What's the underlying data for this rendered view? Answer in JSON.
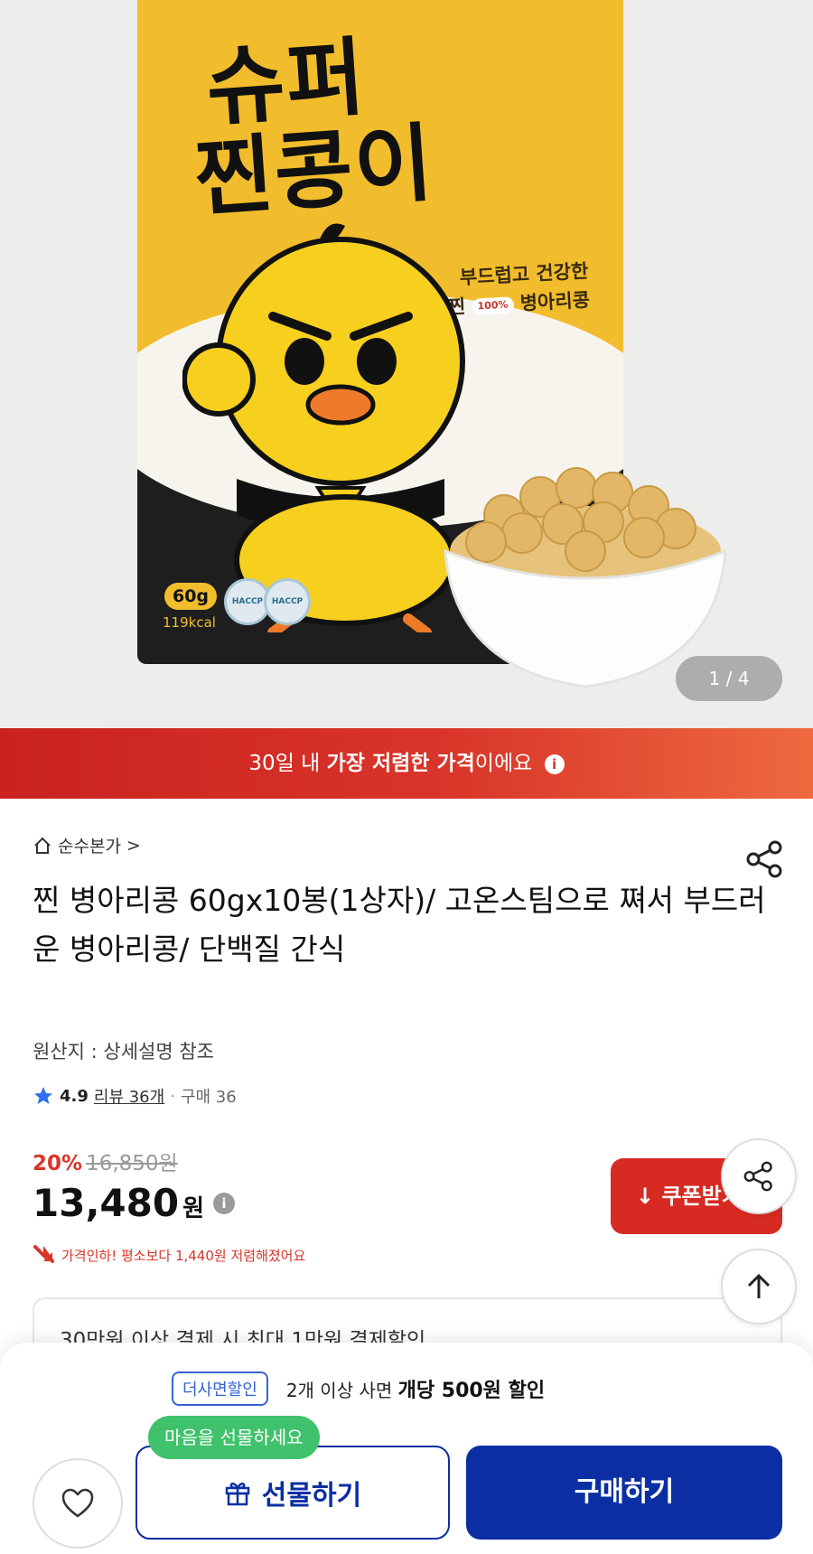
{
  "hero": {
    "product_name_line1": "슈퍼",
    "product_name_line2": "찐콩이",
    "tagline_line1": "부드럽고 건강한",
    "tagline_line2_pre": "찐",
    "tagline_pct": "100%",
    "tagline_line2_post": "병아리콩",
    "weight": "60g",
    "kcal": "119kcal",
    "cert_label": "HACCP",
    "image_counter": "1 / 4"
  },
  "promo": {
    "prefix": "30일 내 ",
    "highlight": "가장 저렴한 가격",
    "suffix": "이에요",
    "info_glyph": "i"
  },
  "product": {
    "store": "순수본가",
    "store_chevron": ">",
    "title": "찐 병아리콩 60gx10봉(1상자)/ 고온스팀으로 쪄서 부드러운 병아리콩/ 단백질 간식",
    "origin": "원산지 : 상세설명 참조",
    "rating": "4.9",
    "reviews": "리뷰 36개",
    "separator": "·",
    "purchases": "구매 36",
    "discount_pct": "20%",
    "original_price": "16,850원",
    "price": "13,480",
    "price_unit": "원",
    "price_info_glyph": "i",
    "coupon_label": "쿠폰받기",
    "price_drop_note": "가격인하! 평소보다 1,440원 저렴해졌어요",
    "card_text": "30만원 이상 결제 시 최대 1만원 결제할인"
  },
  "bottom": {
    "bulk_badge": "더사면할인",
    "bulk_prefix": "2개 이상 사면",
    "bulk_bold": "개당 500원 할인",
    "gift_tooltip": "마음을 선물하세요",
    "gift_label": "선물하기",
    "buy_label": "구매하기"
  },
  "colors": {
    "brand_blue": "#0b2fa3",
    "sale_red": "#d9352a",
    "gift_green": "#3fc26b",
    "pouch_yellow": "#f2bd2c"
  }
}
